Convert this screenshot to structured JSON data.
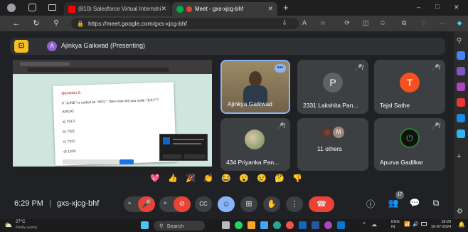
{
  "browser": {
    "tabs": [
      {
        "title": "(810) Salesforce Virtual Internshi",
        "fav_color": "#ff0000"
      },
      {
        "title": "Meet - gxs-xjcg-bhf",
        "fav_color": "#00ac47"
      }
    ],
    "new_tab": "+",
    "url": "https://meet.google.com/gxs-xjcg-bhf",
    "window_controls": [
      "–",
      "□",
      "✕"
    ]
  },
  "meet": {
    "presenting_banner": "Ajinkya Gaikwad (Presenting)",
    "presenter_initial": "A",
    "shared_screen": {
      "question_title": "Question 2:",
      "question_text": "If \"JUNE\" is coded as \"4521\", then how will you code \"JULY\"?",
      "word": "AMCAT",
      "options": [
        "a) 7513",
        "b) 7321",
        "c) 7331",
        "d) 1328"
      ]
    },
    "tiles": [
      {
        "name": "Ajinkya Gaikwad",
        "kind": "video"
      },
      {
        "name": "2331 Lakshita Pan...",
        "initial": "P",
        "avatar_color": "#5f6368"
      },
      {
        "name": "Tejal Sathe",
        "initial": "T",
        "avatar_color": "#f4511e"
      },
      {
        "name": "434 Priyanka Pan...",
        "kind": "photo"
      },
      {
        "name": "11 others",
        "others_initial": "M"
      },
      {
        "name": "Apurva Gadilkar",
        "kind": "logo"
      }
    ],
    "reactions": [
      "💖",
      "👍",
      "🎉",
      "👏",
      "😂",
      "😮",
      "😢",
      "🤔",
      "👎"
    ],
    "time": "6:29 PM",
    "separator": "|",
    "meeting_code": "gxs-xjcg-bhf",
    "participants_count": "17"
  },
  "taskbar": {
    "weather_temp": "27°C",
    "weather_desc": "Partly sunny",
    "search_placeholder": "Search",
    "lang": "ENG",
    "lang_region": "IN",
    "clock_time": "18:29",
    "clock_date": "10-07-2024"
  }
}
